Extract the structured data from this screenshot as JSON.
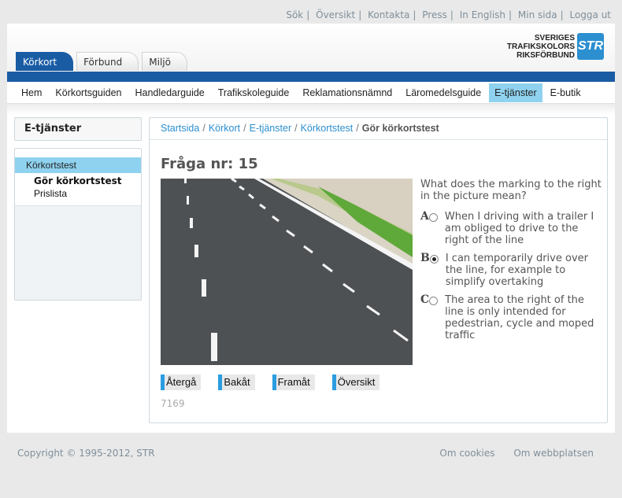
{
  "utility_links": [
    "Sök",
    "Översikt",
    "Kontakta",
    "Press",
    "In English",
    "Min sida",
    "Logga ut"
  ],
  "top_tabs": [
    "Körkort",
    "Förbund",
    "Miljö"
  ],
  "logo": {
    "line1": "SVERIGES",
    "line2": "TRAFIKSKOLORS",
    "line3": "RIKSFÖRBUND",
    "mark": "STR"
  },
  "nav": [
    "Hem",
    "Körkortsguiden",
    "Handledarguide",
    "Trafikskoleguide",
    "Reklamationsnämnd",
    "Läromedelsguide",
    "E-tjänster",
    "E-butik"
  ],
  "sidebar": {
    "heading": "E-tjänster",
    "item_main": "Körkortstest",
    "item_current": "Gör körkortstest",
    "item_other": "Prislista"
  },
  "breadcrumbs": [
    "Startsida",
    "Körkort",
    "E-tjänster",
    "Körkortstest",
    "Gör körkortstest"
  ],
  "question": {
    "title": "Fråga nr: 15",
    "text": "What does the marking to the right in the picture mean?",
    "answers": [
      {
        "letter": "A",
        "text": "When I driving with a trailer I am obliged to drive to the right of the line",
        "selected": false
      },
      {
        "letter": "B",
        "text": "I can temporarily drive over the line, for example to simplify overtaking",
        "selected": true
      },
      {
        "letter": "C",
        "text": "The area to the right of the line is only intended for pedestrian, cycle and moped traffic",
        "selected": false
      }
    ],
    "id": "7169"
  },
  "buttons": [
    "Återgå",
    "Bakåt",
    "Framåt",
    "Översikt"
  ],
  "footer": {
    "copyright": "Copyright © 1995-2012, STR",
    "links": [
      "Om cookies",
      "Om webbplatsen"
    ]
  },
  "colors": {
    "brand_blue": "#1a5ca4",
    "highlight": "#8fd2f0",
    "link": "#2b8fd0"
  }
}
